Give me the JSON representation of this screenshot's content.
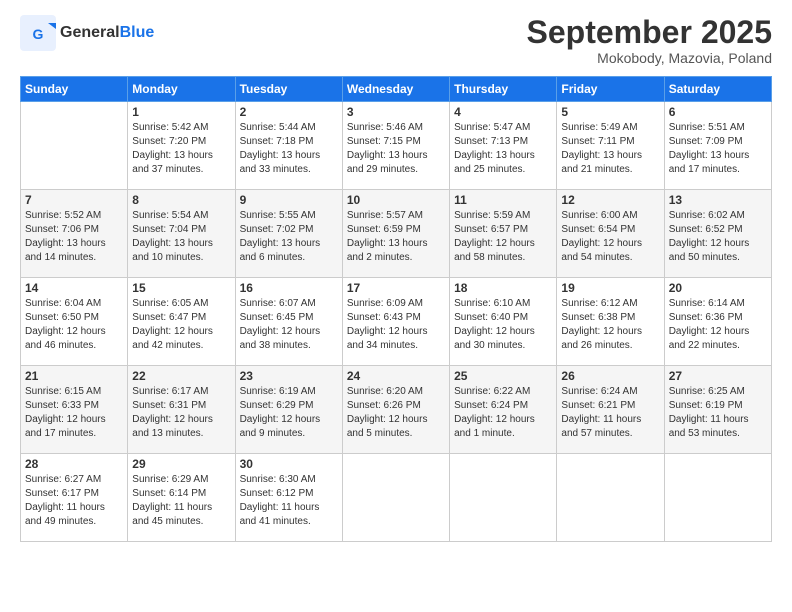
{
  "header": {
    "logo_line1": "General",
    "logo_line2": "Blue",
    "month": "September 2025",
    "location": "Mokobody, Mazovia, Poland"
  },
  "weekdays": [
    "Sunday",
    "Monday",
    "Tuesday",
    "Wednesday",
    "Thursday",
    "Friday",
    "Saturday"
  ],
  "weeks": [
    [
      {
        "num": "",
        "text": ""
      },
      {
        "num": "1",
        "text": "Sunrise: 5:42 AM\nSunset: 7:20 PM\nDaylight: 13 hours\nand 37 minutes."
      },
      {
        "num": "2",
        "text": "Sunrise: 5:44 AM\nSunset: 7:18 PM\nDaylight: 13 hours\nand 33 minutes."
      },
      {
        "num": "3",
        "text": "Sunrise: 5:46 AM\nSunset: 7:15 PM\nDaylight: 13 hours\nand 29 minutes."
      },
      {
        "num": "4",
        "text": "Sunrise: 5:47 AM\nSunset: 7:13 PM\nDaylight: 13 hours\nand 25 minutes."
      },
      {
        "num": "5",
        "text": "Sunrise: 5:49 AM\nSunset: 7:11 PM\nDaylight: 13 hours\nand 21 minutes."
      },
      {
        "num": "6",
        "text": "Sunrise: 5:51 AM\nSunset: 7:09 PM\nDaylight: 13 hours\nand 17 minutes."
      }
    ],
    [
      {
        "num": "7",
        "text": "Sunrise: 5:52 AM\nSunset: 7:06 PM\nDaylight: 13 hours\nand 14 minutes."
      },
      {
        "num": "8",
        "text": "Sunrise: 5:54 AM\nSunset: 7:04 PM\nDaylight: 13 hours\nand 10 minutes."
      },
      {
        "num": "9",
        "text": "Sunrise: 5:55 AM\nSunset: 7:02 PM\nDaylight: 13 hours\nand 6 minutes."
      },
      {
        "num": "10",
        "text": "Sunrise: 5:57 AM\nSunset: 6:59 PM\nDaylight: 13 hours\nand 2 minutes."
      },
      {
        "num": "11",
        "text": "Sunrise: 5:59 AM\nSunset: 6:57 PM\nDaylight: 12 hours\nand 58 minutes."
      },
      {
        "num": "12",
        "text": "Sunrise: 6:00 AM\nSunset: 6:54 PM\nDaylight: 12 hours\nand 54 minutes."
      },
      {
        "num": "13",
        "text": "Sunrise: 6:02 AM\nSunset: 6:52 PM\nDaylight: 12 hours\nand 50 minutes."
      }
    ],
    [
      {
        "num": "14",
        "text": "Sunrise: 6:04 AM\nSunset: 6:50 PM\nDaylight: 12 hours\nand 46 minutes."
      },
      {
        "num": "15",
        "text": "Sunrise: 6:05 AM\nSunset: 6:47 PM\nDaylight: 12 hours\nand 42 minutes."
      },
      {
        "num": "16",
        "text": "Sunrise: 6:07 AM\nSunset: 6:45 PM\nDaylight: 12 hours\nand 38 minutes."
      },
      {
        "num": "17",
        "text": "Sunrise: 6:09 AM\nSunset: 6:43 PM\nDaylight: 12 hours\nand 34 minutes."
      },
      {
        "num": "18",
        "text": "Sunrise: 6:10 AM\nSunset: 6:40 PM\nDaylight: 12 hours\nand 30 minutes."
      },
      {
        "num": "19",
        "text": "Sunrise: 6:12 AM\nSunset: 6:38 PM\nDaylight: 12 hours\nand 26 minutes."
      },
      {
        "num": "20",
        "text": "Sunrise: 6:14 AM\nSunset: 6:36 PM\nDaylight: 12 hours\nand 22 minutes."
      }
    ],
    [
      {
        "num": "21",
        "text": "Sunrise: 6:15 AM\nSunset: 6:33 PM\nDaylight: 12 hours\nand 17 minutes."
      },
      {
        "num": "22",
        "text": "Sunrise: 6:17 AM\nSunset: 6:31 PM\nDaylight: 12 hours\nand 13 minutes."
      },
      {
        "num": "23",
        "text": "Sunrise: 6:19 AM\nSunset: 6:29 PM\nDaylight: 12 hours\nand 9 minutes."
      },
      {
        "num": "24",
        "text": "Sunrise: 6:20 AM\nSunset: 6:26 PM\nDaylight: 12 hours\nand 5 minutes."
      },
      {
        "num": "25",
        "text": "Sunrise: 6:22 AM\nSunset: 6:24 PM\nDaylight: 12 hours\nand 1 minute."
      },
      {
        "num": "26",
        "text": "Sunrise: 6:24 AM\nSunset: 6:21 PM\nDaylight: 11 hours\nand 57 minutes."
      },
      {
        "num": "27",
        "text": "Sunrise: 6:25 AM\nSunset: 6:19 PM\nDaylight: 11 hours\nand 53 minutes."
      }
    ],
    [
      {
        "num": "28",
        "text": "Sunrise: 6:27 AM\nSunset: 6:17 PM\nDaylight: 11 hours\nand 49 minutes."
      },
      {
        "num": "29",
        "text": "Sunrise: 6:29 AM\nSunset: 6:14 PM\nDaylight: 11 hours\nand 45 minutes."
      },
      {
        "num": "30",
        "text": "Sunrise: 6:30 AM\nSunset: 6:12 PM\nDaylight: 11 hours\nand 41 minutes."
      },
      {
        "num": "",
        "text": ""
      },
      {
        "num": "",
        "text": ""
      },
      {
        "num": "",
        "text": ""
      },
      {
        "num": "",
        "text": ""
      }
    ]
  ]
}
